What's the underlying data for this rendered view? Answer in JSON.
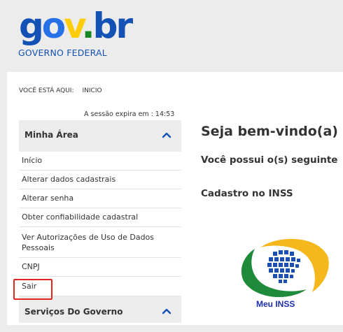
{
  "header": {
    "logo_parts": [
      "g",
      "o",
      "v",
      ".",
      "b",
      "r"
    ],
    "subtitle": "GOVERNO FEDERAL"
  },
  "breadcrumb": {
    "label": "VOCÊ ESTÁ AQUI:",
    "current": "INICIO"
  },
  "session": {
    "text": "A sessão expira em : 14:53"
  },
  "sidebar": {
    "section1_title": "Minha Área",
    "items": [
      {
        "label": "Início"
      },
      {
        "label": "Alterar dados cadastrais"
      },
      {
        "label": "Alterar senha"
      },
      {
        "label": "Obter confiabilidade cadastral"
      },
      {
        "label": "Ver Autorizações de Uso de Dados Pessoais"
      },
      {
        "label": "CNPJ"
      },
      {
        "label": "Sair"
      }
    ],
    "section2_title": "Serviços Do Governo"
  },
  "content": {
    "welcome": "Seja bem-vindo(a)",
    "possui": "Você possui o(s) seguinte",
    "cadastro": "Cadastro no INSS",
    "app_label": "Meu INSS"
  },
  "colors": {
    "accent": "#1351b4",
    "highlight": "#e52521"
  }
}
